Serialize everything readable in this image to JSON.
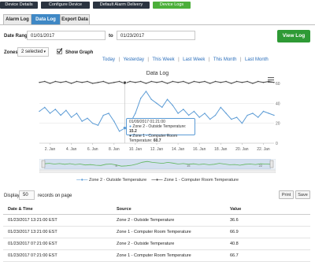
{
  "nav": {
    "items": [
      {
        "label": "Device Details"
      },
      {
        "label": "Configure Device"
      },
      {
        "label": "Default Alarm Delivery"
      },
      {
        "label": "Device Logs"
      }
    ]
  },
  "tabs": [
    {
      "label": "Alarm Log"
    },
    {
      "label": "Data Log"
    },
    {
      "label": "Export Data"
    }
  ],
  "filters": {
    "date_range_label": "Date Range",
    "from": "01/01/2017",
    "to_label": "to",
    "to": "01/23/2017",
    "view_button": "View Log",
    "zones_label": "Zones",
    "zones_value": "2 selected",
    "show_graph_label": "Show Graph",
    "quick": [
      "Today",
      "Yesterday",
      "This Week",
      "Last Week",
      "This Month",
      "Last Month"
    ],
    "quick_sep": "|"
  },
  "chart_data": {
    "type": "line",
    "title": "Data Log",
    "xlabel": "",
    "ylabel": "",
    "ylim": [
      0,
      60
    ],
    "y_ticks_right": [
      "0",
      "20",
      "40",
      "60"
    ],
    "x_ticks": [
      "2. Jan",
      "4. Jan",
      "6. Jan",
      "8. Jan",
      "10. Jan",
      "12. Jan",
      "14. Jan",
      "16. Jan",
      "18. Jan",
      "20. Jan",
      "22. Jan"
    ],
    "series": [
      {
        "name": "Zone 2 - Outside Temperature",
        "color": "#5b9bd5",
        "x": [
          1,
          1.5,
          2,
          2.5,
          3,
          3.5,
          4,
          4.5,
          5,
          5.5,
          6,
          6.5,
          7,
          7.5,
          8,
          8.5,
          9,
          9.5,
          10,
          10.5,
          11,
          11.5,
          12,
          12.5,
          13,
          13.5,
          14,
          14.5,
          15,
          15.5,
          16,
          16.5,
          17,
          17.5,
          18,
          18.5,
          19,
          19.5,
          20,
          20.5,
          21,
          21.5,
          22,
          22.5,
          23
        ],
        "y": [
          32,
          36,
          30,
          34,
          28,
          33,
          26,
          30,
          22,
          25,
          20,
          18,
          28,
          30,
          22,
          12,
          15,
          20,
          30,
          45,
          52,
          44,
          40,
          36,
          44,
          38,
          30,
          34,
          28,
          32,
          26,
          30,
          24,
          28,
          36,
          30,
          24,
          26,
          20,
          28,
          30,
          26,
          32,
          30,
          28
        ]
      },
      {
        "name": "Zone 1 - Computer Room Temperature",
        "color": "#444444",
        "x": [
          1,
          1.5,
          2,
          2.5,
          3,
          3.5,
          4,
          4.5,
          5,
          5.5,
          6,
          6.5,
          7,
          7.5,
          8,
          8.5,
          9,
          9.5,
          10,
          10.5,
          11,
          11.5,
          12,
          12.5,
          13,
          13.5,
          14,
          14.5,
          15,
          15.5,
          16,
          16.5,
          17,
          17.5,
          18,
          18.5,
          19,
          19.5,
          20,
          20.5,
          21,
          21.5,
          22,
          22.5,
          23
        ],
        "y": [
          61,
          62,
          60,
          62,
          61,
          62,
          60,
          62,
          61,
          62,
          60,
          61,
          62,
          60,
          61,
          62,
          60,
          62,
          61,
          62,
          60,
          62,
          61,
          62,
          60,
          62,
          61,
          62,
          60,
          62,
          61,
          62,
          60,
          62,
          61,
          62,
          60,
          62,
          61,
          62,
          60,
          62,
          61,
          62,
          61
        ]
      }
    ],
    "tooltip": {
      "date": "01/09/2017 01:21:00",
      "line1_label": "Zone 2 - Outside Temperature:",
      "line1_value": "15.2",
      "line2_label": "Zone 1 - Computer Room Temperature:",
      "line2_value": "60.7"
    },
    "legend": [
      {
        "name": "Zone 2 - Outside Temperature",
        "color": "#5b9bd5"
      },
      {
        "name": "Zone 1 - Computer Room Temperature",
        "color": "#444444"
      }
    ],
    "legend_position": "bottom"
  },
  "navigator": {
    "x_ticks": [
      "8",
      "15",
      "22"
    ]
  },
  "table": {
    "display_label": "Display",
    "page_size": "50",
    "records_label": "records on page",
    "print_label": "Print",
    "save_label": "Save",
    "headers": [
      "Date & Time",
      "Source",
      "Value"
    ],
    "rows": [
      [
        "01/23/2017 13:21:00 EST",
        "Zone 2 - Outside Temperature",
        "36.6"
      ],
      [
        "01/23/2017 13:21:00 EST",
        "Zone 1 - Computer Room Temperature",
        "66.9"
      ],
      [
        "01/23/2017 07:21:00 EST",
        "Zone 2 - Outside Temperature",
        "40.8"
      ],
      [
        "01/23/2017 07:21:00 EST",
        "Zone 1 - Computer Room Temperature",
        "66.7"
      ]
    ]
  }
}
